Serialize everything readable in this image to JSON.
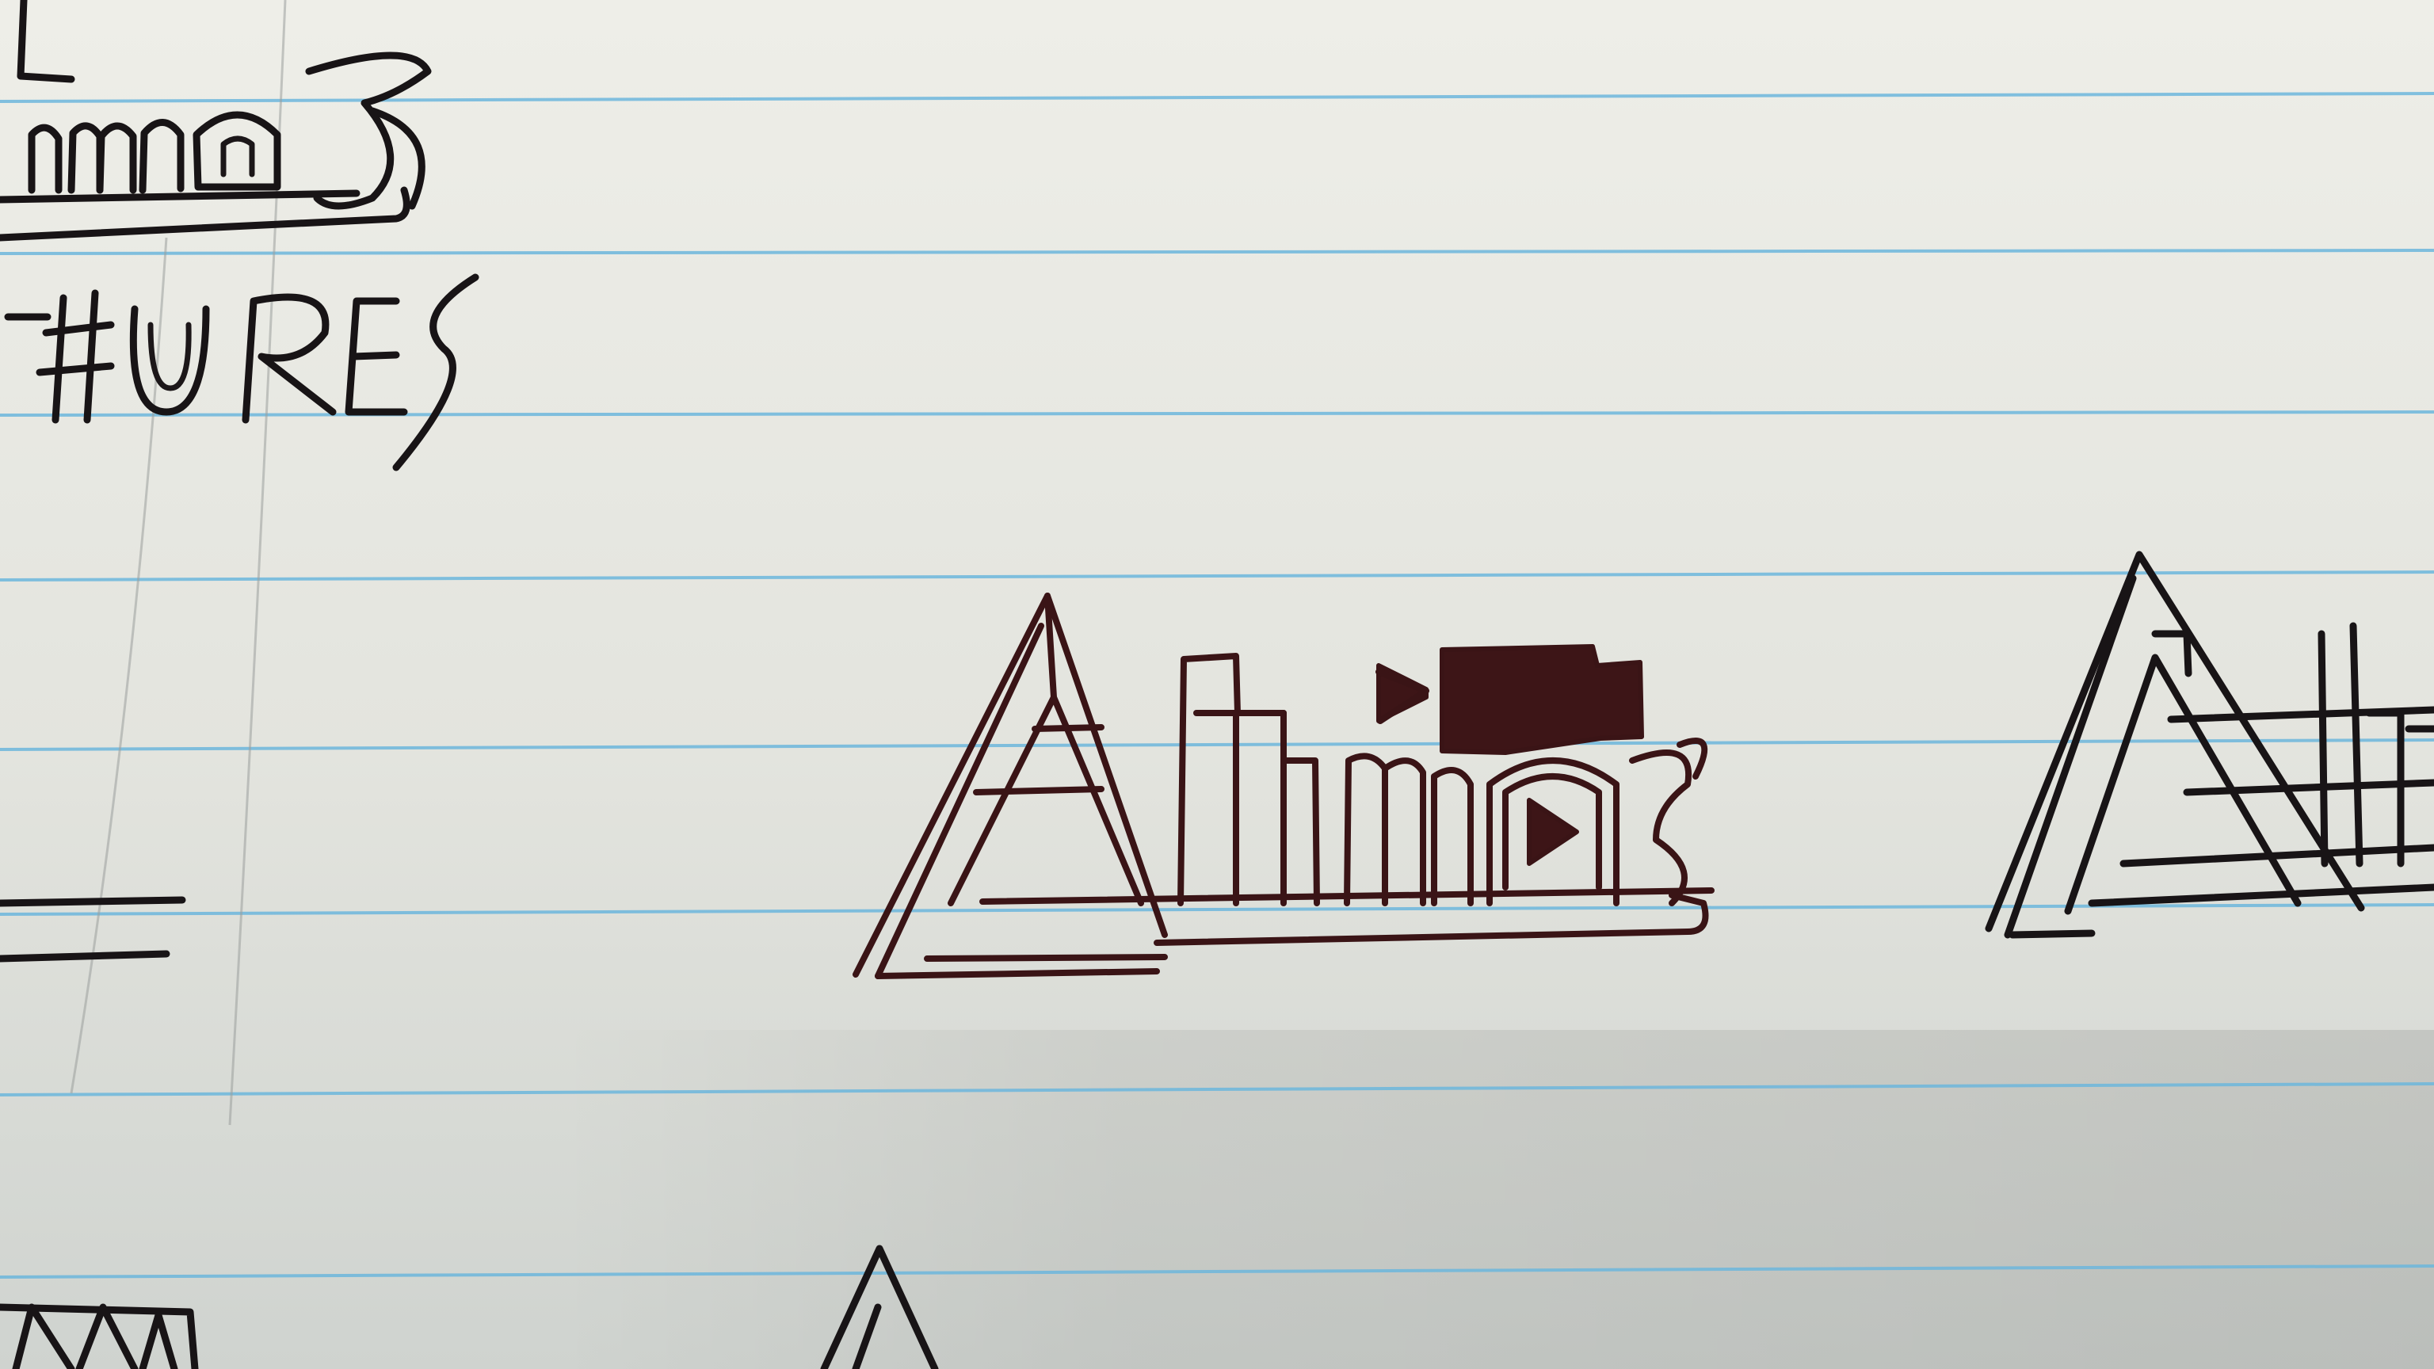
{
  "photo": {
    "subject": "",
    "sketch_texts": {
      "top_left_wordmark": "Atmos",
      "top_left_subline": "TURES",
      "center_wordmark": "Atmos"
    },
    "colors": {
      "paper": "#e6e6e1",
      "rule_blue": "#6cb6dc",
      "ink_black": "#181416",
      "ink_brown": "#3a1416"
    },
    "icons": [
      "film-camera-icon",
      "play-button-icon"
    ]
  }
}
